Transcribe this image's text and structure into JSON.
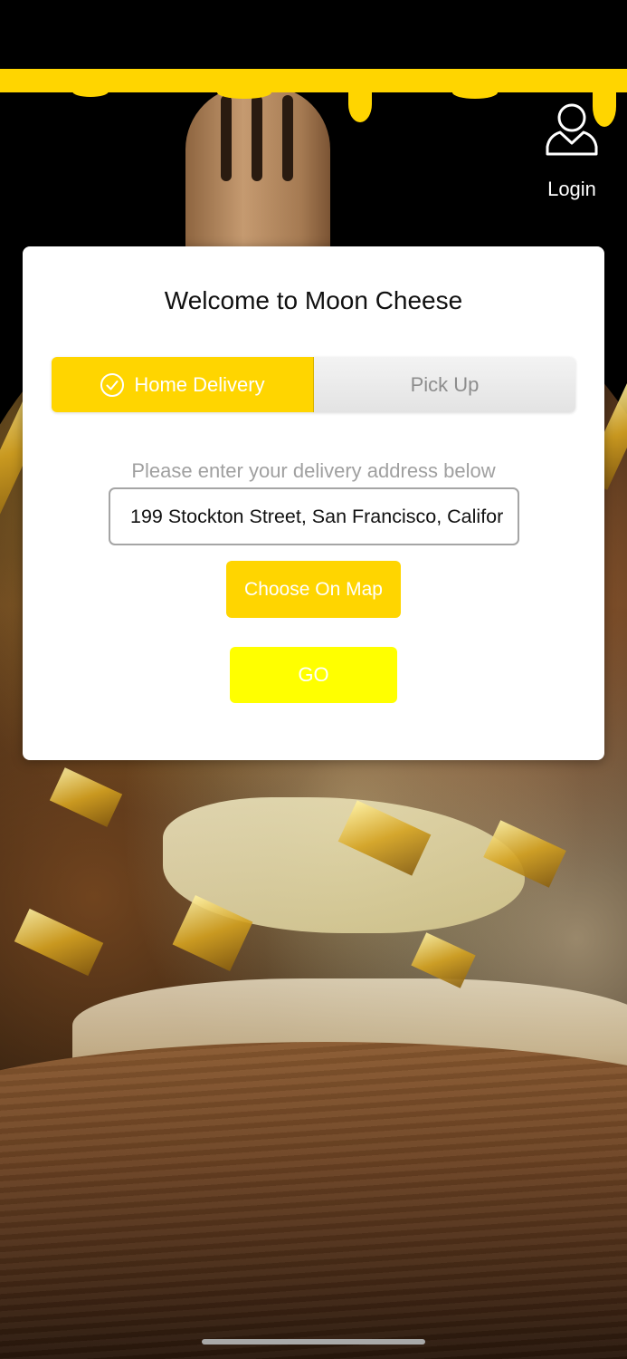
{
  "header": {
    "login_label": "Login",
    "login_icon": "user-icon"
  },
  "modal": {
    "title": "Welcome to Moon Cheese",
    "options": [
      {
        "label": "Home Delivery",
        "selected": true,
        "icon": "check-circle-icon"
      },
      {
        "label": "Pick Up",
        "selected": false
      }
    ],
    "helper_text": "Please enter your delivery address below",
    "address_value": "199 Stockton Street, San Francisco, Califor",
    "choose_on_map_label": "Choose On Map",
    "go_label": "GO"
  },
  "colors": {
    "accent": "#ffd500",
    "go_button": "#ffff00",
    "pickup_text": "#8d8d8d",
    "helper_text": "#a0a0a0"
  }
}
